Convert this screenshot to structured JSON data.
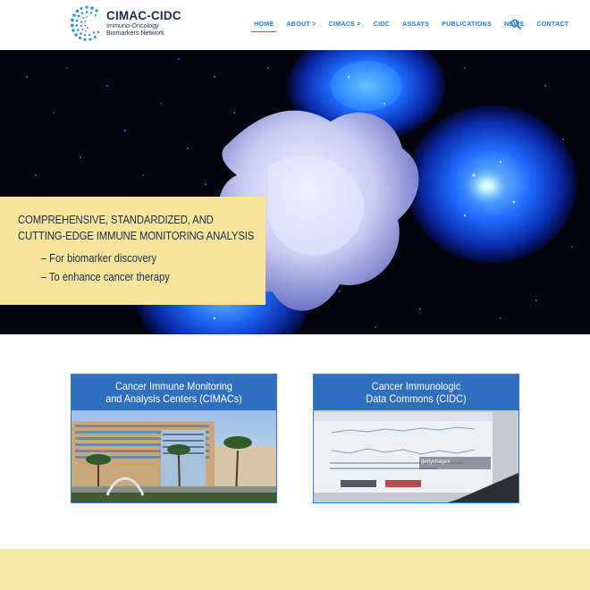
{
  "brand": {
    "title": "CIMAC-CIDC",
    "subtitle_line1": "Immuno-Oncology",
    "subtitle_line2": "Biomarkers Network"
  },
  "nav": {
    "items": [
      {
        "label": "HOME",
        "active": true
      },
      {
        "label": "ABOUT >",
        "active": false
      },
      {
        "label": "CIMACS >",
        "active": false
      },
      {
        "label": "CIDC",
        "active": false
      },
      {
        "label": "ASSAYS",
        "active": false
      },
      {
        "label": "PUBLICATIONS",
        "active": false
      },
      {
        "label": "NEWS",
        "active": false
      },
      {
        "label": "CONTACT",
        "active": false
      }
    ],
    "search_icon": "search-icon"
  },
  "hero": {
    "headline_line1": "COMPREHENSIVE, STANDARDIZED, AND",
    "headline_line2": "CUTTING-EDGE IMMUNE MONITORING ANALYSIS",
    "point1": "– For biomarker discovery",
    "point2": "– To enhance cancer therapy"
  },
  "cards": [
    {
      "title_line1": "Cancer Immune Monitoring",
      "title_line2": "and Analysis Centers (CIMACs)"
    },
    {
      "title_line1": "Cancer Immunologic",
      "title_line2": "Data Commons (CIDC)",
      "image_watermark": "gettyimages"
    }
  ],
  "colors": {
    "accent": "#2a7fd0",
    "card_header": "#2f6fbe",
    "hero_box": "#f7e59b",
    "footer_band": "#f7e9a8",
    "text_dark": "#1d2b4f"
  }
}
